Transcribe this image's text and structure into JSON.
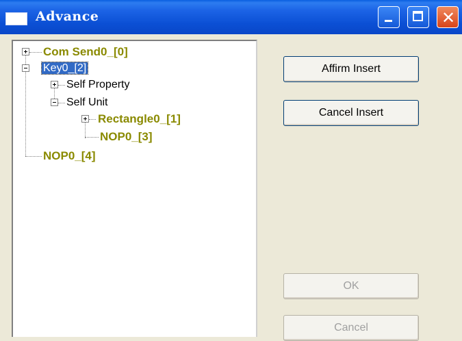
{
  "window": {
    "title": "Advance",
    "controls": {
      "minimize": "minimize-icon",
      "maximize": "maximize-icon",
      "close": "close-icon"
    }
  },
  "tree": {
    "nodes": [
      {
        "label": "Com Send0_[0]",
        "expander": "plus",
        "level": 0
      },
      {
        "label": "Key0_[2]",
        "expander": "minus",
        "level": 0,
        "selected": true
      },
      {
        "label": "Self Property",
        "expander": "plus",
        "level": 1
      },
      {
        "label": "Self Unit",
        "expander": "minus",
        "level": 1
      },
      {
        "label": "Rectangle0_[1]",
        "expander": "plus",
        "level": 2
      },
      {
        "label": "NOP0_[3]",
        "expander": "none",
        "level": 2
      },
      {
        "label": "NOP0_[4]",
        "expander": "none",
        "level": 0
      }
    ]
  },
  "buttons": {
    "affirm_insert": "Affirm Insert",
    "cancel_insert": "Cancel Insert",
    "ok": "OK",
    "cancel": "Cancel"
  },
  "colors": {
    "titlebar": "#0a4fd4",
    "tree_label_olive": "#8a8a00",
    "selection": "#316ac5",
    "dialog_bg": "#ece9d8"
  }
}
